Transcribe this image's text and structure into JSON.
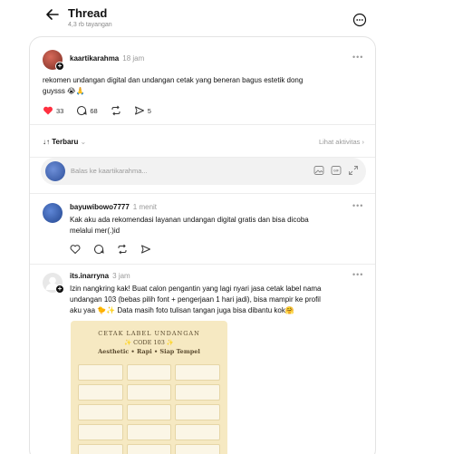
{
  "header": {
    "title": "Thread",
    "views": "4,3 rb tayangan"
  },
  "post": {
    "username": "kaartikarahma",
    "time": "18 jam",
    "text_line1": "rekomen undangan digital dan undangan cetak yang beneran bagus estetik dong",
    "text_line2": "guysss 😭🙏",
    "likes": "33",
    "comments": "68",
    "shares": "5",
    "like_color": "#ff3040"
  },
  "sort": {
    "label": "Terbaru",
    "activity_link": "Lihat aktivitas"
  },
  "reply_box": {
    "placeholder": "Balas ke kaartikarahma..."
  },
  "replies": [
    {
      "username": "bayuwibowo7777",
      "time": "1 menit",
      "line1": "Kak aku ada rekomendasi layanan undangan digital gratis dan bisa dicoba",
      "line2": "melalui mer(.)id"
    },
    {
      "username": "its.inarryna",
      "time": "3 jam",
      "line1": "Izin nangkring kak! Buat calon pengantin yang lagi nyari jasa cetak label nama",
      "line2": "undangan 103 (bebas pilih font + pengerjaan 1 hari jadi), bisa mampir ke profil",
      "line3": "aku yaa 🐤✨ Data masih foto tulisan tangan juga bisa dibantu kok🤗"
    }
  ],
  "image": {
    "title": "CETAK LABEL UNDANGAN",
    "code": "✨ CODE 103 ✨",
    "tagline": "Aesthetic • Rapi • Siap Tempel"
  },
  "icons": {
    "back": "arrow-left-icon",
    "more": "more-circle-icon",
    "like": "heart-icon",
    "comment": "comment-icon",
    "repost": "repost-icon",
    "share": "share-icon",
    "gif": "gif-icon",
    "image": "image-icon",
    "expand": "expand-icon"
  }
}
